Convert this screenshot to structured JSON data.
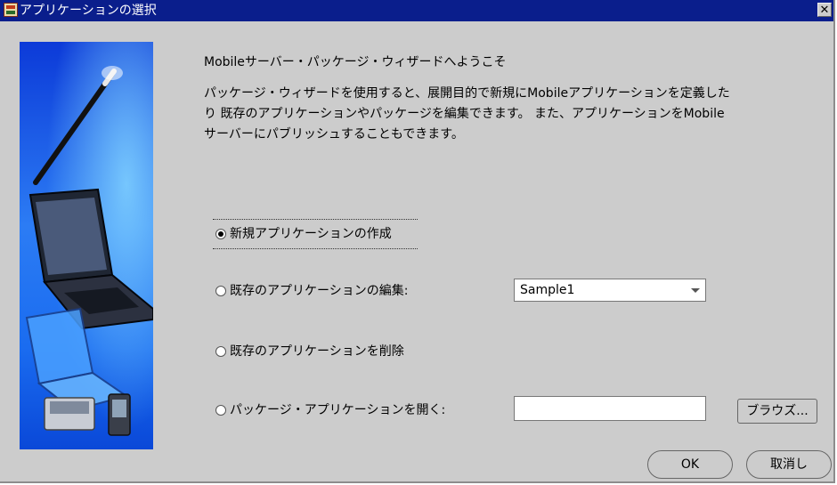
{
  "window": {
    "title": "アプリケーションの選択",
    "close_glyph": "✕"
  },
  "side_image": {
    "description_icons": [
      "magic-wand-icon",
      "laptop-icon",
      "laptop-icon",
      "pda-icon"
    ],
    "background_color": "#1a5cff"
  },
  "welcome": "Mobileサーバー・パッケージ・ウィザードへようこそ",
  "description_lines": [
    "パッケージ・ウィザードを使用すると、展開目的で新規にMobileアプリケーションを定義した",
    "り 既存のアプリケーションやパッケージを編集できます。 また、アプリケーションをMobile",
    "サーバーにパブリッシュすることもできます。"
  ],
  "options": {
    "create": {
      "label": "新規アプリケーションの作成",
      "selected": true
    },
    "edit": {
      "label": "既存のアプリケーションの編集:",
      "selected": false
    },
    "delete": {
      "label": "既存のアプリケーションを削除",
      "selected": false
    },
    "open": {
      "label": "パッケージ・アプリケーションを開く:",
      "selected": false
    }
  },
  "edit_select": {
    "value": "Sample1"
  },
  "open_path": {
    "value": ""
  },
  "buttons": {
    "browse": "ブラウズ...",
    "ok": "OK",
    "cancel": "取消し"
  }
}
